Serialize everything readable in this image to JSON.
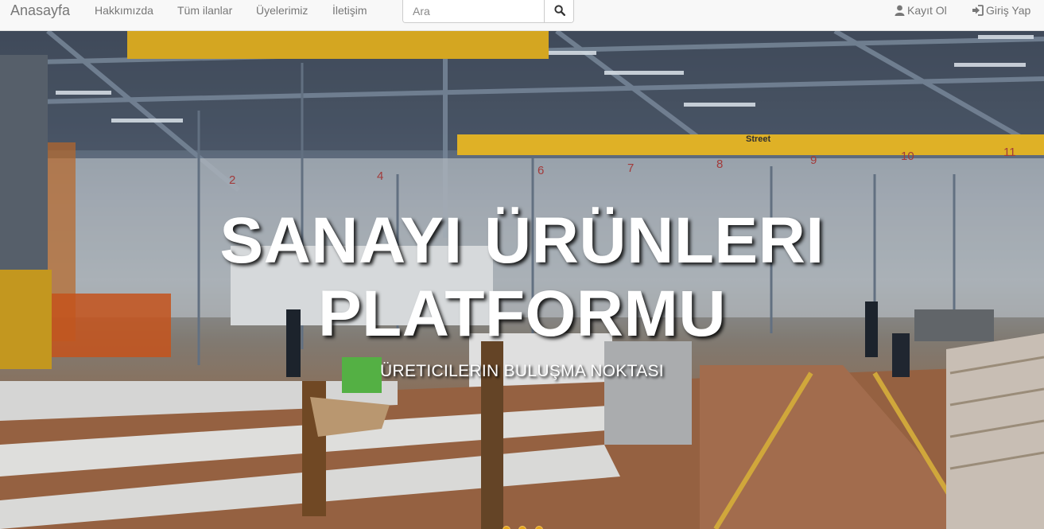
{
  "navbar": {
    "brand": "Anasayfa",
    "links": [
      "Hakkımızda",
      "Tüm ilanlar",
      "Üyelerimiz",
      "İletişim"
    ],
    "search": {
      "placeholder": "Ara",
      "value": ""
    },
    "register": "Kayıt Ol",
    "login": "Giriş Yap"
  },
  "hero": {
    "title": "SANAYI ÜRÜNLERI PLATFORMU",
    "subtitle": "ÜRETICILERIN BULUŞMA NOKTASI",
    "slide_count": 3,
    "active_slide": 1,
    "background_photo": {
      "crane_label": "Street",
      "bay_numbers": [
        "2",
        "4",
        "6",
        "7",
        "8",
        "9",
        "10",
        "11"
      ]
    }
  },
  "colors": {
    "navbar_bg": "#f8f8f8",
    "nav_text": "#777777",
    "indicator": "#e2a11b",
    "crane_yellow": "#f2c02a"
  }
}
